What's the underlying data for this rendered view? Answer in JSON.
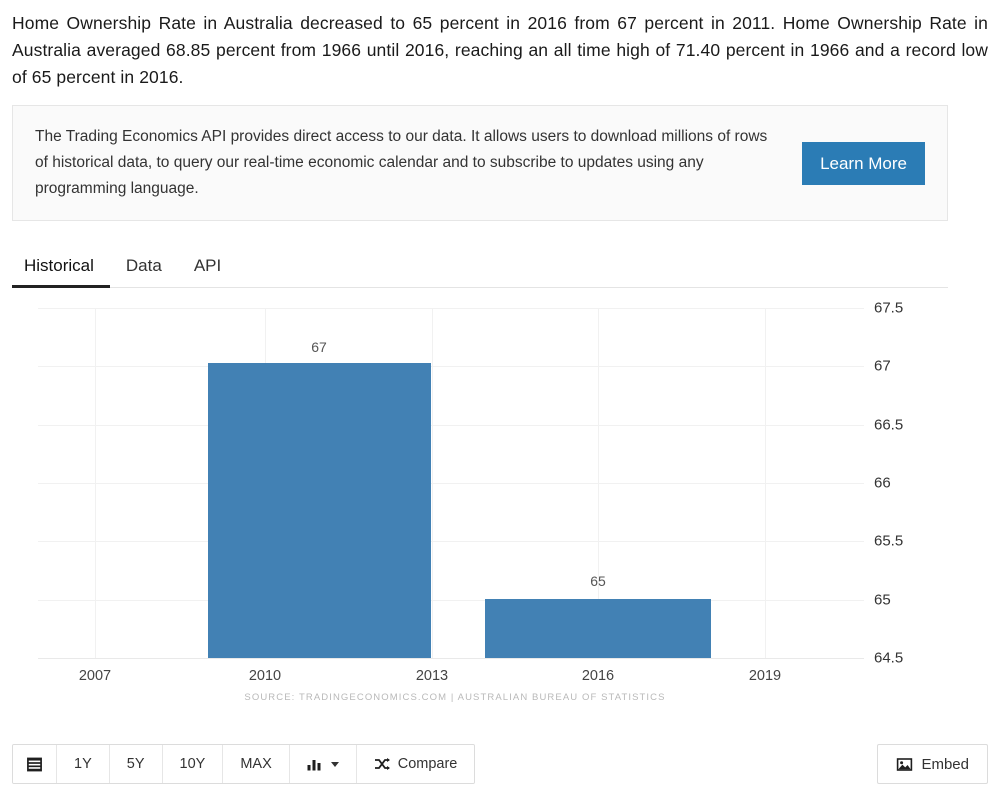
{
  "intro": {
    "paragraph": "Home Ownership Rate in Australia decreased to 65 percent in 2016 from 67 percent in 2011. Home Ownership Rate in Australia averaged 68.85 percent from 1966 until 2016, reaching an all time high of 71.40 percent in 1966 and a record low of 65 percent in 2016."
  },
  "promo": {
    "text": "The Trading Economics API provides direct access to our data. It allows users to download millions of rows of historical data, to query our real-time economic calendar and to subscribe to updates using any programming language.",
    "button_label": "Learn More",
    "button_color": "#2b7cb5"
  },
  "tabs": [
    {
      "label": "Historical",
      "active": true
    },
    {
      "label": "Data",
      "active": false
    },
    {
      "label": "API",
      "active": false
    }
  ],
  "chart_data": {
    "type": "bar",
    "title": "",
    "xlabel": "",
    "ylabel": "",
    "categories": [
      "2011",
      "2016"
    ],
    "values": [
      67,
      65
    ],
    "bar_color": "#4281b4",
    "ylim": [
      64.5,
      67.5
    ],
    "yticks": [
      "67.5",
      "67",
      "66.5",
      "66",
      "65.5",
      "65",
      "64.5"
    ],
    "ytick_values": [
      67.5,
      67,
      66.5,
      66,
      65.5,
      65,
      64.5
    ],
    "xticks": [
      "2007",
      "2010",
      "2013",
      "2016",
      "2019"
    ],
    "xtick_values": [
      2007,
      2010,
      2013,
      2016,
      2019
    ],
    "data_labels": [
      "67",
      "65"
    ],
    "grid": true,
    "legend": false,
    "source": "SOURCE: TRADINGECONOMICS.COM  |  AUSTRALIAN BUREAU OF STATISTICS"
  },
  "toolbar": {
    "calendar_label": "",
    "ranges": [
      "1Y",
      "5Y",
      "10Y",
      "MAX"
    ],
    "chart_type_label": "",
    "compare_label": "Compare",
    "embed_label": "Embed"
  }
}
